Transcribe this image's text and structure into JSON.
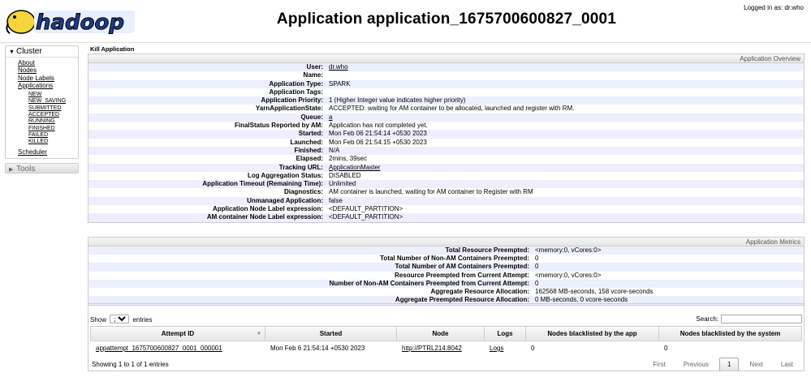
{
  "header": {
    "logo_text": "hadoop",
    "title": "Application application_1675700600827_0001",
    "logged_in": "Logged in as: dr.who"
  },
  "sidebar": {
    "cluster_label": "Cluster",
    "links": [
      "About",
      "Nodes",
      "Node Labels",
      "Applications"
    ],
    "states": [
      "NEW",
      "NEW_SAVING",
      "SUBMITTED",
      "ACCEPTED",
      "RUNNING",
      "FINISHED",
      "FAILED",
      "KILLED"
    ],
    "scheduler": "Scheduler",
    "tools_label": "Tools"
  },
  "kill_label": "Kill Application",
  "overview": {
    "heading": "Application Overview",
    "rows": [
      {
        "k": "User:",
        "v": "dr.who",
        "link": true
      },
      {
        "k": "Name:",
        "v": ""
      },
      {
        "k": "Application Type:",
        "v": "SPARK"
      },
      {
        "k": "Application Tags:",
        "v": ""
      },
      {
        "k": "Application Priority:",
        "v": "1 (Higher Integer value indicates higher priority)"
      },
      {
        "k": "YarnApplicationState:",
        "v": "ACCEPTED: waiting for AM container to be allocated, launched and register with RM."
      },
      {
        "k": "Queue:",
        "v": "a",
        "link": true
      },
      {
        "k": "FinalStatus Reported by AM:",
        "v": "Application has not completed yet."
      },
      {
        "k": "Started:",
        "v": "Mon Feb 06 21:54:14 +0530 2023"
      },
      {
        "k": "Launched:",
        "v": "Mon Feb 06 21:54:15 +0530 2023"
      },
      {
        "k": "Finished:",
        "v": "N/A"
      },
      {
        "k": "Elapsed:",
        "v": "2mins, 39sec"
      },
      {
        "k": "Tracking URL:",
        "v": "ApplicationMaster",
        "link": true
      },
      {
        "k": "Log Aggregation Status:",
        "v": "DISABLED"
      },
      {
        "k": "Application Timeout (Remaining Time):",
        "v": "Unlimited"
      },
      {
        "k": "Diagnostics:",
        "v": "AM container is launched, waiting for AM container to Register with RM"
      },
      {
        "k": "Unmanaged Application:",
        "v": "false"
      },
      {
        "k": "Application Node Label expression:",
        "v": "<DEFAULT_PARTITION>"
      },
      {
        "k": "AM container Node Label expression:",
        "v": "<DEFAULT_PARTITION>"
      }
    ]
  },
  "metrics": {
    "heading": "Application Metrics",
    "rows": [
      {
        "k": "Total Resource Preempted:",
        "v": "<memory:0, vCores:0>"
      },
      {
        "k": "Total Number of Non-AM Containers Preempted:",
        "v": "0"
      },
      {
        "k": "Total Number of AM Containers Preempted:",
        "v": "0"
      },
      {
        "k": "Resource Preempted from Current Attempt:",
        "v": "<memory:0, vCores:0>"
      },
      {
        "k": "Number of Non-AM Containers Preempted from Current Attempt:",
        "v": "0"
      },
      {
        "k": "Aggregate Resource Allocation:",
        "v": "162568 MB-seconds, 158 vcore-seconds"
      },
      {
        "k": "Aggregate Preempted Resource Allocation:",
        "v": "0 MB-seconds, 0 vcore-seconds"
      }
    ]
  },
  "attempts": {
    "show_label": "Show",
    "show_value": "20",
    "entries_label": "entries",
    "search_label": "Search:",
    "columns": [
      "Attempt ID",
      "Started",
      "Node",
      "Logs",
      "Nodes blacklisted by the app",
      "Nodes blacklisted by the system"
    ],
    "rows": [
      [
        "appattempt_1675700600827_0001_000001",
        "Mon Feb 6 21:54:14 +0530 2023",
        "http://PTRL214:8042",
        "Logs",
        "0",
        "0"
      ]
    ],
    "info": "Showing 1 to 1 of 1 entries",
    "pagination": {
      "first": "First",
      "previous": "Previous",
      "current": "1",
      "next": "Next",
      "last": "Last"
    }
  },
  "colors": {
    "stripe": "#eeeeff",
    "border": "#cccccc"
  }
}
